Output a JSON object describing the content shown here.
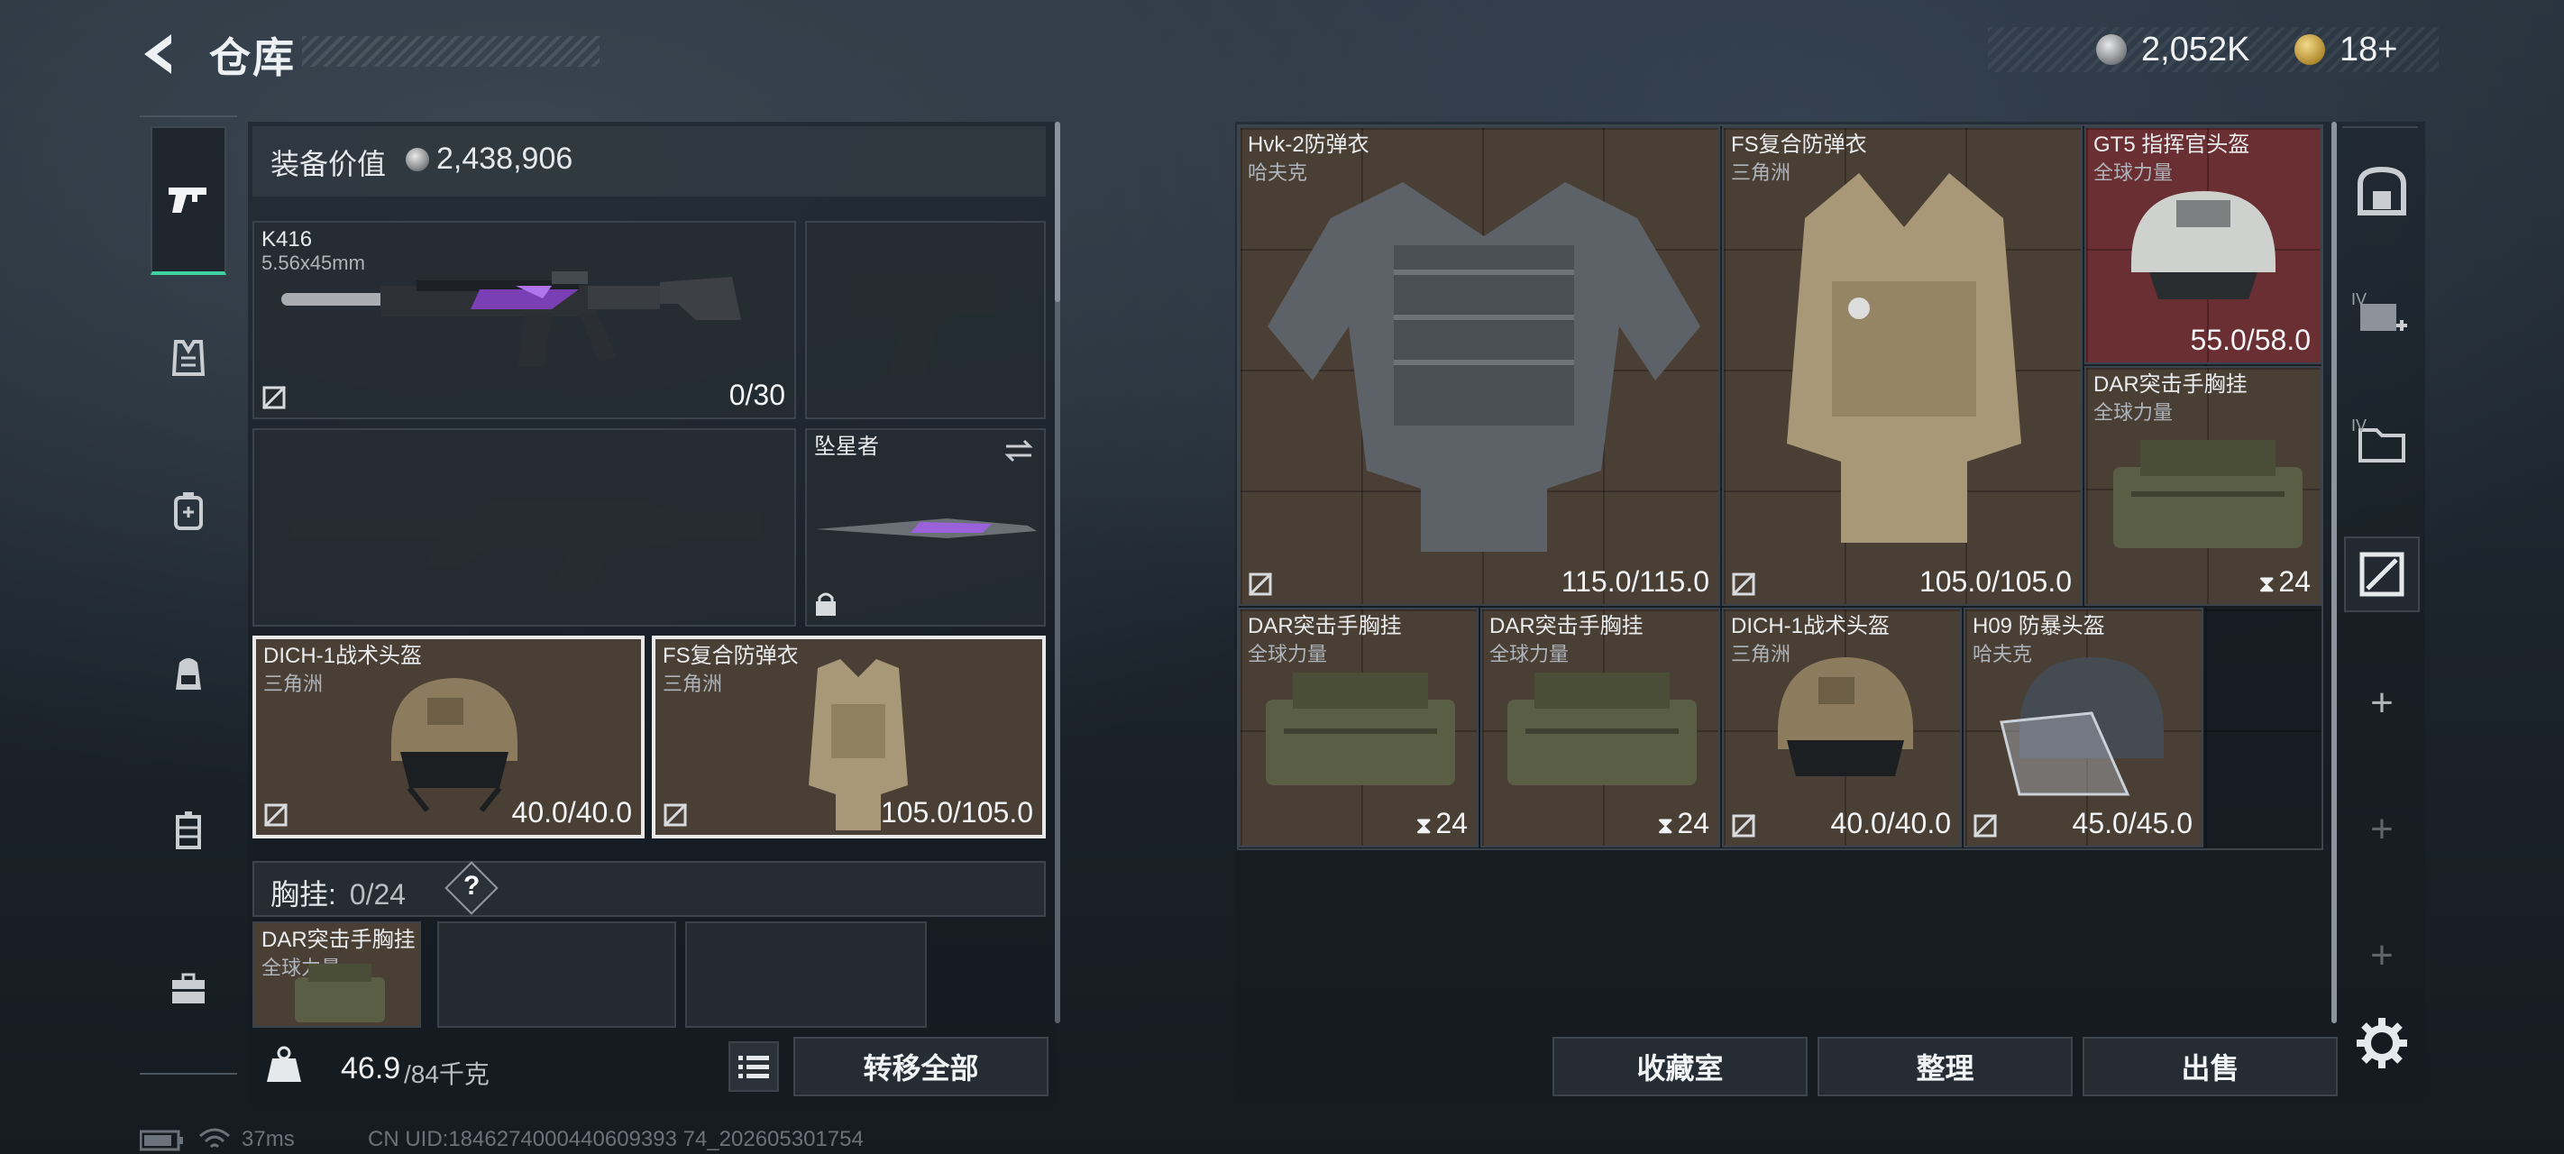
{
  "header": {
    "title": "仓库",
    "silver_value": "2,052K",
    "gold_value": "18+"
  },
  "left_rail": {
    "tabs": [
      {
        "id": "weapons",
        "icon": "pistol-icon",
        "active": true
      },
      {
        "id": "armor",
        "icon": "vest-icon"
      },
      {
        "id": "consumables",
        "icon": "pack-icon"
      },
      {
        "id": "backpack",
        "icon": "backpack-icon"
      },
      {
        "id": "container",
        "icon": "container-icon"
      },
      {
        "id": "case",
        "icon": "briefcase-icon"
      }
    ]
  },
  "equipment": {
    "value_label": "装备价值",
    "value": "2,438,906",
    "primary_weapon": {
      "name": "K416",
      "caliber": "5.56x45mm",
      "ammo": "0/30"
    },
    "melee": {
      "name": "坠星者"
    },
    "helmet": {
      "name": "DICH-1战术头盔",
      "brand": "三角洲",
      "durability": "40.0/40.0"
    },
    "armor": {
      "name": "FS复合防弹衣",
      "brand": "三角洲",
      "durability": "105.0/105.0"
    },
    "chest_label": "胸挂:",
    "chest_capacity": "0/24",
    "help": "?",
    "chest_item": {
      "name": "DAR突击手胸挂",
      "brand": "全球力量"
    },
    "weight_current": "46.9",
    "weight_max": "/84千克",
    "transfer_all": "转移全部"
  },
  "stash": {
    "items": [
      {
        "name": "Hvk-2防弹衣",
        "brand": "哈夫克",
        "value": "115.0/115.0"
      },
      {
        "name": "FS复合防弹衣",
        "brand": "三角洲",
        "value": "105.0/105.0"
      },
      {
        "name": "GT5 指挥官头盔",
        "brand": "全球力量",
        "value": "55.0/58.0"
      },
      {
        "name": "DAR突击手胸挂",
        "brand": "全球力量",
        "value": "24"
      },
      {
        "name": "DAR突击手胸挂",
        "brand": "全球力量",
        "value": "24"
      },
      {
        "name": "DAR突击手胸挂",
        "brand": "全球力量",
        "value": "24"
      },
      {
        "name": "DICH-1战术头盔",
        "brand": "三角洲",
        "value": "40.0/40.0"
      },
      {
        "name": "H09 防暴头盔",
        "brand": "哈夫克",
        "value": "45.0/45.0"
      }
    ],
    "right_rail_badges": [
      "IV",
      "IV"
    ],
    "buttons": {
      "store": "收藏室",
      "sort": "整理",
      "sell": "出售"
    }
  },
  "footer": {
    "ping": "37ms",
    "uid": "CN UID:1846274000440609393 74_202605301754"
  },
  "colors": {
    "accent": "#3fd2a3",
    "slot_brown": "#4a3f35",
    "slot_rust": "#6a2f33"
  }
}
